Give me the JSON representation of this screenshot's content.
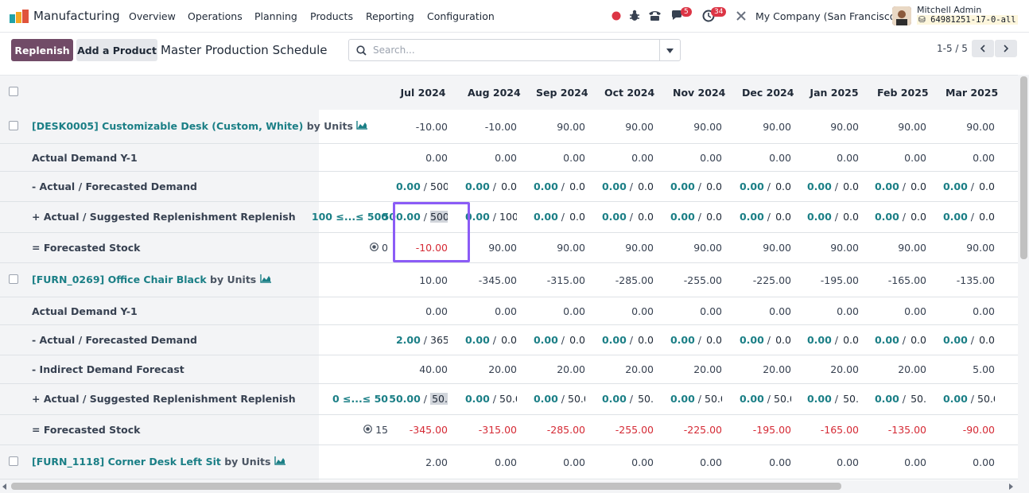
{
  "navbar": {
    "app_name": "Manufacturing",
    "menu": [
      "Overview",
      "Operations",
      "Planning",
      "Products",
      "Reporting",
      "Configuration"
    ],
    "messages_badge": "5",
    "activities_badge": "34",
    "company": "My Company (San Francisco)",
    "user_name": "Mitchell Admin",
    "db_name": "64981251-17-0-all"
  },
  "control": {
    "replenish_label": "Replenish",
    "add_product_label": "Add a Product",
    "title": "Master Production Schedule",
    "search_placeholder": "Search...",
    "pager": "1-5 / 5"
  },
  "months": [
    "Jul 2024",
    "Aug 2024",
    "Sep 2024",
    "Oct 2024",
    "Nov 2024",
    "Dec 2024",
    "Jan 2025",
    "Feb 2025",
    "Mar 2025"
  ],
  "products": [
    {
      "name": "[DESK0005] Customizable Desk (Custom, White)",
      "uom": "by Units",
      "values": [
        "-10.00",
        "-10.00",
        "90.00",
        "90.00",
        "90.00",
        "90.00",
        "90.00",
        "90.00",
        "90.00"
      ],
      "actual_demand_y1": {
        "label": "Actual Demand Y-1",
        "values": [
          "0.00",
          "0.00",
          "0.00",
          "0.00",
          "0.00",
          "0.00",
          "0.00",
          "0.00",
          "0.00"
        ]
      },
      "forecasted_demand": {
        "label": "- Actual / Forecasted Demand",
        "actual": [
          "0.00",
          "0.00",
          "0.00",
          "0.00",
          "0.00",
          "0.00",
          "0.00",
          "0.00",
          "0.00"
        ],
        "forecast": [
          "500",
          "0.0",
          "0.0",
          "0.0",
          "0.0",
          "0.0",
          "0.0",
          "0.0",
          "0.0"
        ]
      },
      "replenishment": {
        "label": "+ Actual / Suggested Replenishment",
        "link": "Replenish",
        "range": "100 ≤...≤ 500",
        "actual": [
          "500.00",
          "0.00",
          "0.00",
          "0.00",
          "0.00",
          "0.00",
          "0.00",
          "0.00",
          "0.00"
        ],
        "suggested": [
          "500",
          "100",
          "0.0",
          "0.0",
          "0.0",
          "0.0",
          "0.0",
          "0.0",
          "0.0"
        ]
      },
      "forecasted_stock": {
        "label": "= Forecasted Stock",
        "safety": "0",
        "values": [
          "-10.00",
          "90.00",
          "90.00",
          "90.00",
          "90.00",
          "90.00",
          "90.00",
          "90.00",
          "90.00"
        ]
      }
    },
    {
      "name": "[FURN_0269] Office Chair Black",
      "uom": "by Units",
      "values": [
        "10.00",
        "-345.00",
        "-315.00",
        "-285.00",
        "-255.00",
        "-225.00",
        "-195.00",
        "-165.00",
        "-135.00"
      ],
      "actual_demand_y1": {
        "label": "Actual Demand Y-1",
        "values": [
          "0.00",
          "0.00",
          "0.00",
          "0.00",
          "0.00",
          "0.00",
          "0.00",
          "0.00",
          "0.00"
        ]
      },
      "forecasted_demand": {
        "label": "- Actual / Forecasted Demand",
        "actual": [
          "2.00",
          "0.00",
          "0.00",
          "0.00",
          "0.00",
          "0.00",
          "0.00",
          "0.00",
          "0.00"
        ],
        "forecast": [
          "365",
          "0.0",
          "0.0",
          "0.0",
          "0.0",
          "0.0",
          "0.0",
          "0.0",
          "0.0"
        ]
      },
      "indirect_demand": {
        "label": "- Indirect Demand Forecast",
        "values": [
          "40.00",
          "20.00",
          "20.00",
          "20.00",
          "20.00",
          "20.00",
          "20.00",
          "20.00",
          "5.00"
        ]
      },
      "replenishment": {
        "label": "+ Actual / Suggested Replenishment",
        "link": "Replenish",
        "range": "0 ≤...≤ 50",
        "actual": [
          "50.00",
          "0.00",
          "0.00",
          "0.00",
          "0.00",
          "0.00",
          "0.00",
          "0.00",
          "0.00"
        ],
        "suggested": [
          "50.",
          "50.0",
          "50.0",
          "50.",
          "50.0",
          "50.0",
          "50.",
          "50.",
          "50.0"
        ]
      },
      "forecasted_stock": {
        "label": "= Forecasted Stock",
        "safety": "15",
        "values": [
          "-345.00",
          "-315.00",
          "-285.00",
          "-255.00",
          "-225.00",
          "-195.00",
          "-165.00",
          "-135.00",
          "-90.00"
        ]
      }
    },
    {
      "name": "[FURN_1118] Corner Desk Left Sit",
      "uom": "by Units",
      "values": [
        "2.00",
        "0.00",
        "0.00",
        "0.00",
        "0.00",
        "0.00",
        "0.00",
        "0.00",
        "0.00"
      ]
    }
  ],
  "colors": {
    "brand": "#714b67",
    "teal": "#1b7f86",
    "negative": "#d52a35",
    "highlight": "#8b5cf6"
  }
}
